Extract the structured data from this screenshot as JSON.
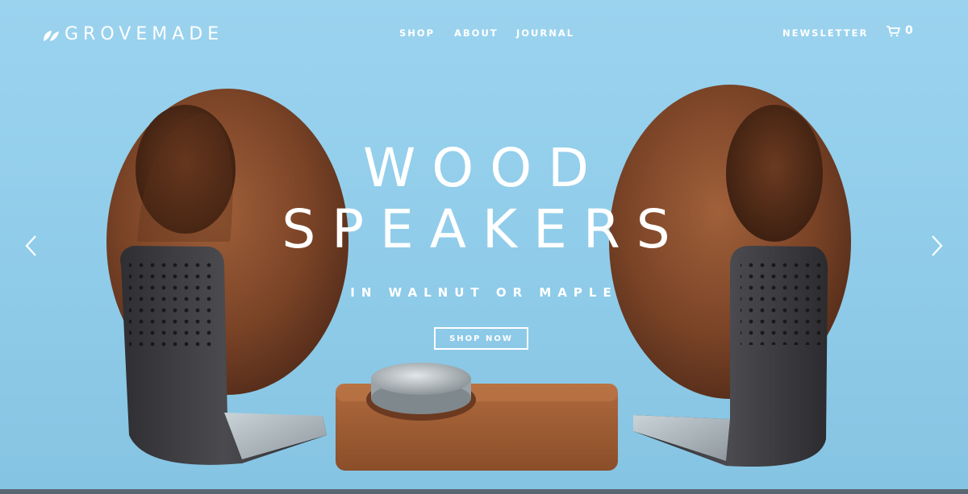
{
  "brand": {
    "name": "GROVEMADE",
    "logo_icon": "leaf-icon"
  },
  "nav": {
    "items": [
      "SHOP",
      "ABOUT",
      "JOURNAL"
    ]
  },
  "header_right": {
    "newsletter": "NEWSLETTER",
    "cart_count": "0",
    "cart_icon": "cart-icon"
  },
  "hero": {
    "title_line1": "WOOD",
    "title_line2": "SPEAKERS",
    "subtitle": "IN WALNUT OR MAPLE",
    "cta": "SHOP NOW"
  },
  "colors": {
    "background": "#8fcbea",
    "text": "#ffffff",
    "walnut": "#7a4326",
    "steel": "#3f3f43"
  }
}
